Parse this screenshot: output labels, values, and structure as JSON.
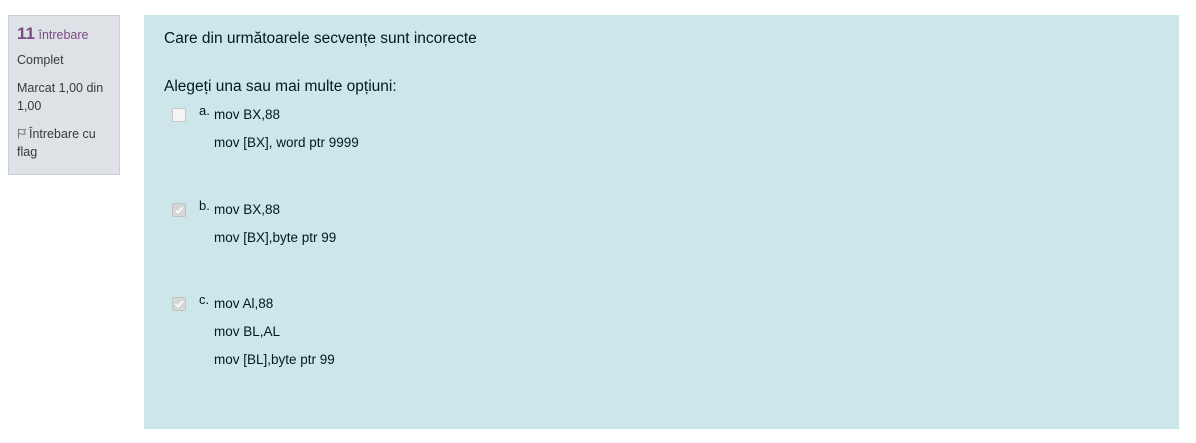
{
  "info": {
    "number": "11",
    "label": "întrebare",
    "state": "Complet",
    "grade": "Marcat 1,00 din 1,00",
    "flag_label": "Întrebare cu flag",
    "flag_icon": "flag-outline-icon"
  },
  "question": {
    "text": "Care din următoarele secvențe sunt incorecte",
    "prompt": "Alegeți una sau mai multe opțiuni:",
    "options": [
      {
        "letter": "a.",
        "checked": false,
        "lines": [
          "mov BX,88",
          "mov [BX], word ptr 9999"
        ]
      },
      {
        "letter": "b.",
        "checked": true,
        "lines": [
          "mov BX,88",
          "mov [BX],byte ptr 99"
        ]
      },
      {
        "letter": "c.",
        "checked": true,
        "lines": [
          "mov Al,88",
          "mov BL,AL",
          "mov [BL],byte ptr 99"
        ]
      }
    ]
  },
  "colors": {
    "content_bg": "#cce6ea",
    "info_bg": "#dee2e6",
    "accent": "#7a4a83"
  }
}
